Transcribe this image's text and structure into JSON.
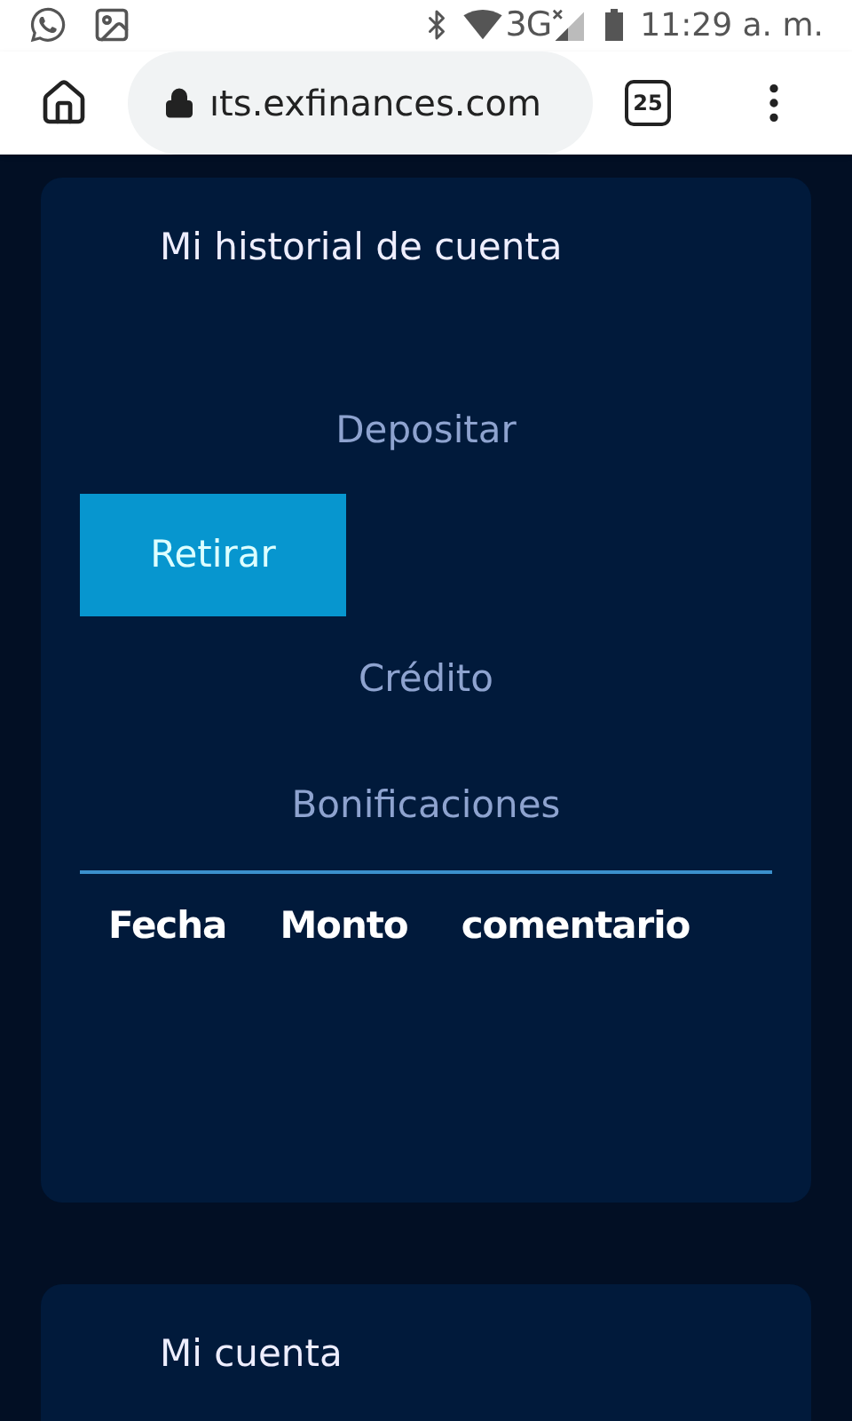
{
  "status_bar": {
    "network": "3G",
    "time": "11:29 a. m."
  },
  "browser": {
    "url": "ıts.exfinances.com",
    "tab_count": "25"
  },
  "history_card": {
    "title": "Mi historial de cuenta",
    "tabs": [
      {
        "label": "Depositar",
        "selected": false
      },
      {
        "label": "Retirar",
        "selected": true
      },
      {
        "label": "Crédito",
        "selected": false
      },
      {
        "label": "Bonificaciones",
        "selected": false
      }
    ],
    "table": {
      "columns": [
        "Fecha",
        "Monto",
        "comentario"
      ]
    }
  },
  "account_card": {
    "title": "Mi cuenta"
  }
}
